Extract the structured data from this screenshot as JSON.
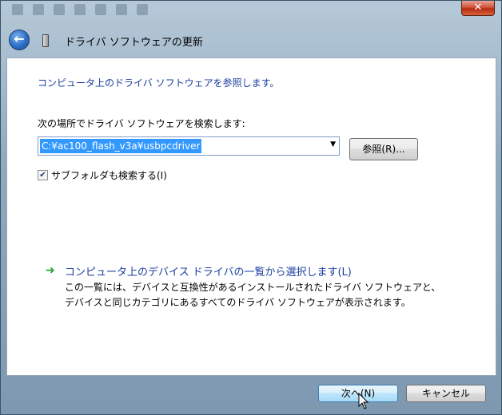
{
  "header": {
    "title": "ドライバ ソフトウェアの更新"
  },
  "window": {
    "close_label": "✕"
  },
  "main": {
    "instruction": "コンピュータ上のドライバ ソフトウェアを参照します。",
    "search_label": "次の場所でドライバ ソフトウェアを検索します:",
    "path_value": "C:¥ac100_flash_v3a¥usbpcdriver",
    "browse_button": "参照(R)...",
    "include_subfolders": {
      "label": "サブフォルダも検索する(I)",
      "checked": true
    },
    "pick_link": "コンピュータ上のデバイス ドライバの一覧から選択します(L)",
    "pick_description": "この一覧には、デバイスと互換性があるインストールされたドライバ ソフトウェアと、デバイスと同じカテゴリにあるすべてのドライバ ソフトウェアが表示されます。"
  },
  "footer": {
    "next_button": "次へ(N)",
    "cancel_button": "キャンセル"
  },
  "icons": {
    "back": "back-arrow-icon",
    "device": "device-icon",
    "pick_arrow": "green-arrow-icon",
    "checkbox_mark": "checkmark-icon"
  },
  "colors": {
    "link": "#1a3e9e",
    "selection": "#3399ff",
    "close": "#c8391b",
    "next_button_border": "#3c7fb1"
  }
}
